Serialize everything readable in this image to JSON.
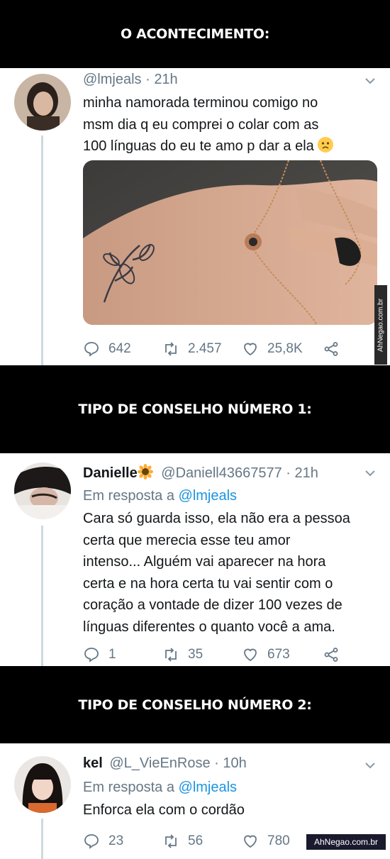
{
  "sections": {
    "s0": "O ACONTECIMENTO:",
    "s1": "TIPO DE CONSELHO NÚMERO 1:",
    "s2": "TIPO DE CONSELHO NÚMERO 2:"
  },
  "tweets": [
    {
      "handle_line": "@lmjeals · 21h",
      "body_lines": [
        "minha namorada terminou comigo no",
        "msm dia q eu comprei o colar com as",
        "100 línguas do eu te amo p dar a ela"
      ],
      "emoji_icon": "worried-face-icon",
      "replies": "642",
      "retweets": "2.457",
      "likes": "25,8K"
    },
    {
      "name": "Danielle",
      "name_icon": "sunflower-icon",
      "handle_line": "@Daniell43667577 · 21h",
      "reply_prefix": "Em resposta a",
      "reply_to": "@lmjeals",
      "body_lines": [
        "Cara só guarda isso, ela não era a pessoa",
        "certa que merecia esse teu amor",
        "intenso... Alguém vai aparecer na hora",
        "certa e na hora certa tu vai sentir com o",
        "coração a vontade de dizer 100 vezes de",
        "línguas diferentes o quanto você a ama."
      ],
      "replies": "1",
      "retweets": "35",
      "likes": "673"
    },
    {
      "name": "kel",
      "handle_line": "@L_VieEnRose · 10h",
      "reply_prefix": "Em resposta a",
      "reply_to": "@lmjeals",
      "body_lines": [
        "Enforca ela com o cordão"
      ],
      "replies": "23",
      "retweets": "56",
      "likes": "780"
    }
  ],
  "watermarks": {
    "side": "AhNegao.com.br",
    "bottom": "AhNegao.com.br"
  },
  "colors": {
    "link": "#1b95e0",
    "muted": "#657786",
    "text": "#14171a",
    "banner": "#000000"
  }
}
